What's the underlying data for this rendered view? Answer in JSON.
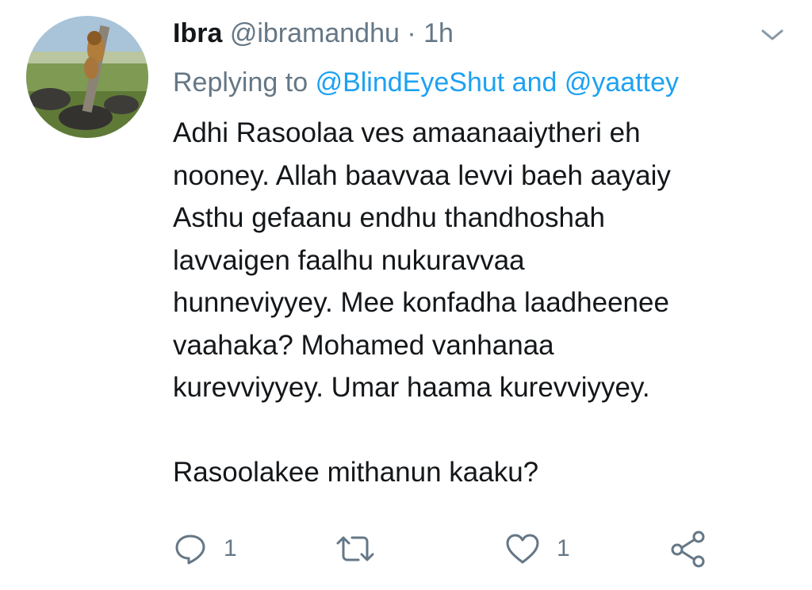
{
  "tweet": {
    "name": "Ibra",
    "handle": "@ibramandhu",
    "separator": "·",
    "time": "1h",
    "replying_prefix": "Replying to",
    "mention_1": "@BlindEyeShut",
    "mention_joiner": "and",
    "mention_2": "@yaattey",
    "body_lines": [
      "Adhi Rasoolaa ves amaanaaiytheri eh",
      "nooney. Allah baavvaa levvi baeh aayaiy",
      "Asthu gefaanu endhu thandhoshah",
      "lavvaigen faalhu nukuravvaa",
      "hunneviyyey. Mee konfadha laadheenee",
      "vaahaka? Mohamed vanhanaa",
      "kurevviyyey. Umar haama kurevviyyey."
    ],
    "body_last_line": "Rasoolakee mithanun kaaku?"
  },
  "actions": {
    "reply_count": "1",
    "retweet_count": "",
    "like_count": "1"
  },
  "icons": {
    "menu": "chevron-down-icon",
    "reply": "reply-icon",
    "retweet": "retweet-icon",
    "like": "heart-icon",
    "share": "share-icon"
  },
  "colors": {
    "text": "#14171a",
    "secondary": "#657786",
    "link": "#1da1f2"
  }
}
